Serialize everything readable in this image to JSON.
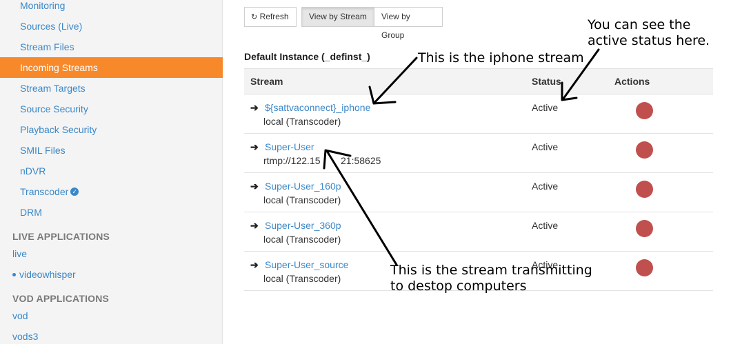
{
  "sidebar": {
    "items": [
      {
        "label": "Monitoring"
      },
      {
        "label": "Sources (Live)"
      },
      {
        "label": "Stream Files"
      },
      {
        "label": "Incoming Streams"
      },
      {
        "label": "Stream Targets"
      },
      {
        "label": "Source Security"
      },
      {
        "label": "Playback Security"
      },
      {
        "label": "SMIL Files"
      },
      {
        "label": "nDVR"
      },
      {
        "label": "Transcoder"
      },
      {
        "label": "DRM"
      }
    ],
    "live_heading": "LIVE APPLICATIONS",
    "live_apps": [
      "live",
      "videowhisper"
    ],
    "vod_heading": "VOD APPLICATIONS",
    "vod_apps": [
      "vod",
      "vods3"
    ],
    "active_color": "#f7892b",
    "link_color": "#3a87c8"
  },
  "toolbar": {
    "refresh_icon": "↻",
    "refresh_label": "Refresh",
    "view_by_stream_label": "View by Stream",
    "view_by_group_label": "View by Group"
  },
  "instance_title": "Default Instance (_definst_)",
  "table": {
    "headers": {
      "stream": "Stream",
      "status": "Status",
      "actions": "Actions"
    },
    "rows": [
      {
        "name": "${sattvaconnect}_iphone",
        "source": "local (Transcoder)",
        "status": "Active"
      },
      {
        "name": "Super-User",
        "source": "rtmp://122.15",
        "source_tail": "21:58625",
        "status": "Active"
      },
      {
        "name": "Super-User_160p",
        "source": "local (Transcoder)",
        "status": "Active"
      },
      {
        "name": "Super-User_360p",
        "source": "local (Transcoder)",
        "status": "Active"
      },
      {
        "name": "Super-User_source",
        "source": "local (Transcoder)",
        "status": "Active"
      }
    ],
    "action_color": "#c0504d"
  },
  "annotations": {
    "iphone": "This is the iphone stream",
    "status_line1": "You can see the",
    "status_line2": "active status here.",
    "desktop_line1": "This is the stream transmitting",
    "desktop_line2": "to destop computers"
  }
}
